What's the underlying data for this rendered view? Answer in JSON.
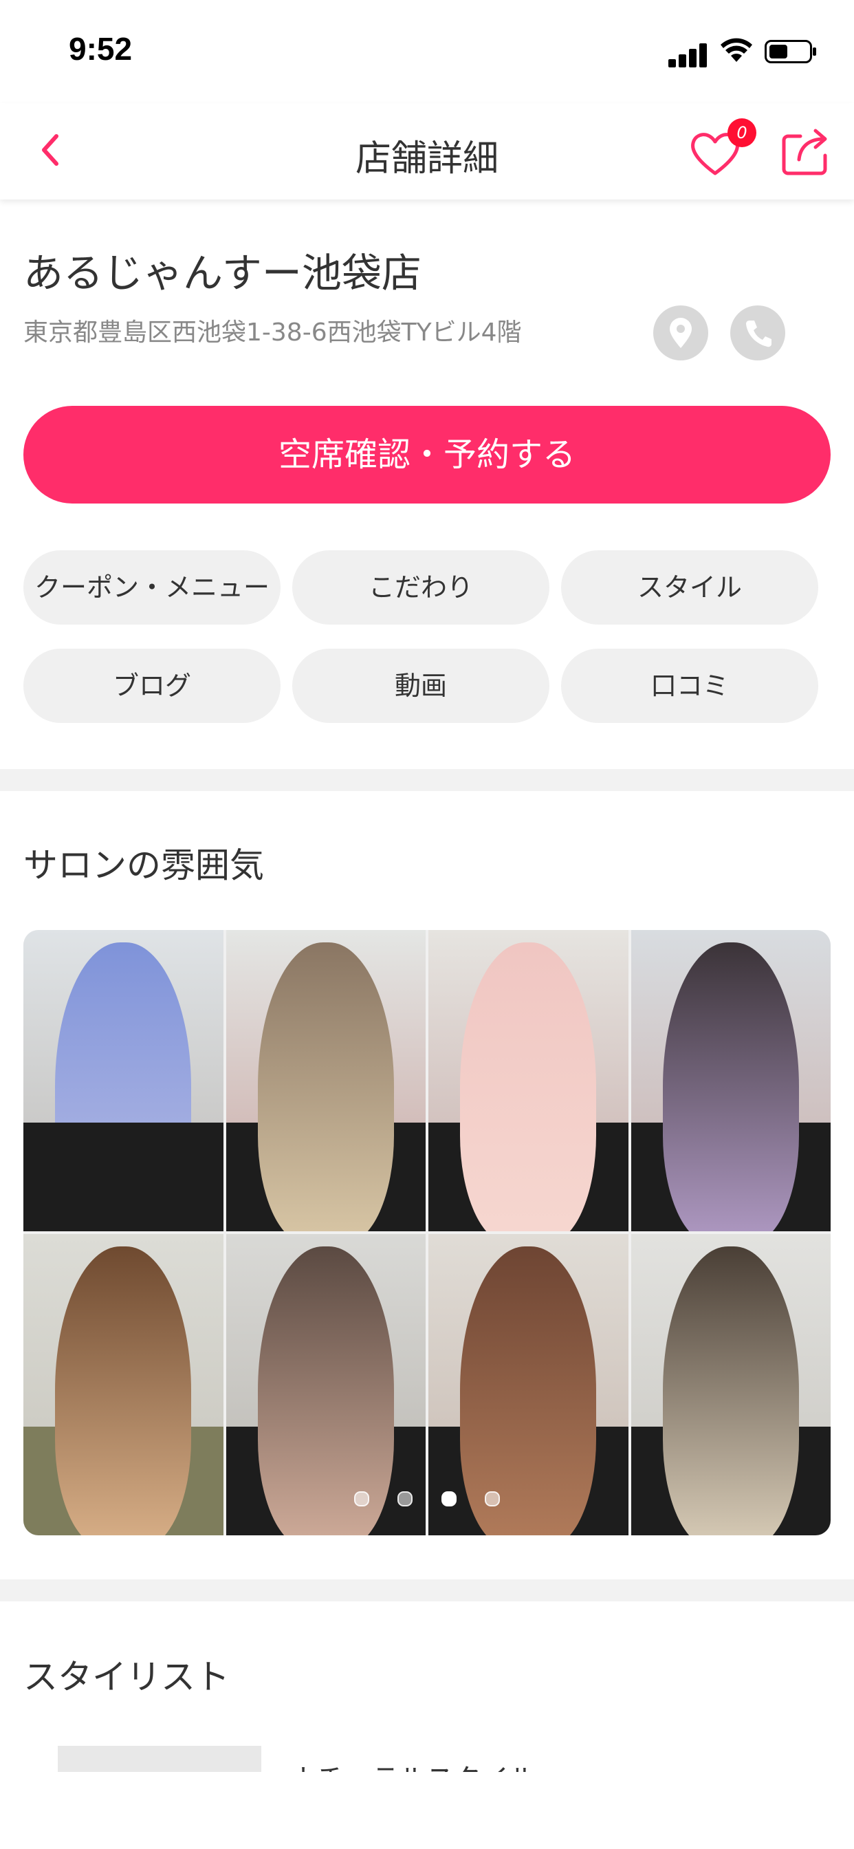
{
  "status_bar": {
    "time": "9:52"
  },
  "nav": {
    "title": "店舗詳細",
    "favorite_count": "0"
  },
  "salon": {
    "name": "あるじゃんすー池袋店",
    "address": "東京都豊島区西池袋1-38-6西池袋TYビル4階"
  },
  "reserve_button": "空席確認・予約する",
  "tabs": [
    {
      "label": "クーポン・メニュー"
    },
    {
      "label": "こだわり"
    },
    {
      "label": "スタイル"
    },
    {
      "label": "ブログ"
    },
    {
      "label": "動画"
    },
    {
      "label": "口コミ"
    }
  ],
  "atmosphere": {
    "title": "サロンの雰囲気",
    "pages": 4,
    "active_page": 3
  },
  "stylist": {
    "title": "スタイリスト",
    "first_name_partial": "ナチュラルスタイル"
  },
  "colors": {
    "accent": "#ff2d6a",
    "badge": "#ff0f33",
    "chip_bg": "#f0f0f0"
  }
}
